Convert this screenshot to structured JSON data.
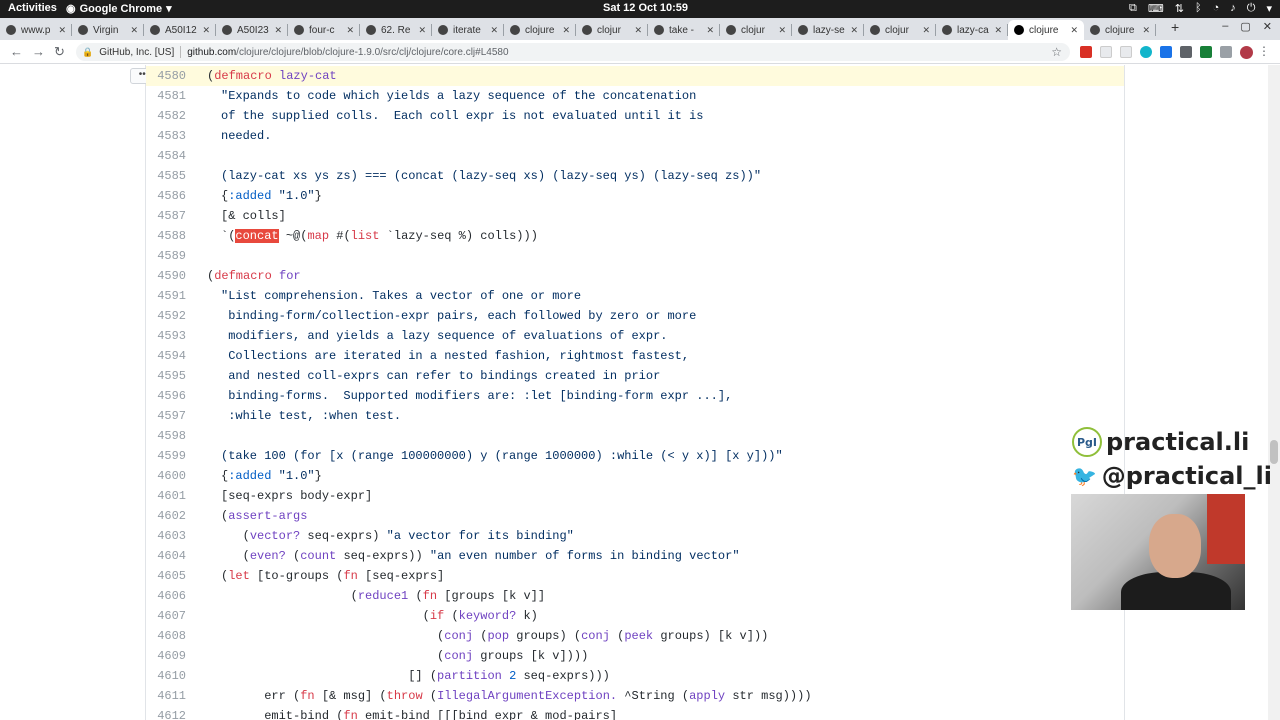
{
  "topbar": {
    "activities": "Activities",
    "app_name": "Google Chrome",
    "clock": "Sat 12 Oct  10:59"
  },
  "tabs": [
    {
      "label": "www.p",
      "active": false
    },
    {
      "label": "Virgin",
      "active": false
    },
    {
      "label": "A50I12",
      "active": false
    },
    {
      "label": "A50I23",
      "active": false
    },
    {
      "label": "four-c",
      "active": false
    },
    {
      "label": "62. Re",
      "active": false
    },
    {
      "label": "iterate",
      "active": false
    },
    {
      "label": "clojure",
      "active": false
    },
    {
      "label": "clojur",
      "active": false
    },
    {
      "label": "take -",
      "active": false
    },
    {
      "label": "clojur",
      "active": false
    },
    {
      "label": "lazy-se",
      "active": false
    },
    {
      "label": "clojur",
      "active": false
    },
    {
      "label": "lazy-ca",
      "active": false
    },
    {
      "label": "clojure",
      "active": true
    },
    {
      "label": "clojure",
      "active": false
    }
  ],
  "address_bar": {
    "org": "GitHub, Inc. [US]",
    "host": "github.com",
    "path": "/clojure/clojure/blob/clojure-1.9.0/src/clj/clojure/core.clj#L4580"
  },
  "code_lines": [
    {
      "n": "4580",
      "hl": true
    },
    {
      "n": "4581"
    },
    {
      "n": "4582"
    },
    {
      "n": "4583"
    },
    {
      "n": "4584"
    },
    {
      "n": "4585"
    },
    {
      "n": "4586"
    },
    {
      "n": "4587"
    },
    {
      "n": "4588"
    },
    {
      "n": "4589"
    },
    {
      "n": "4590"
    },
    {
      "n": "4591"
    },
    {
      "n": "4592"
    },
    {
      "n": "4593"
    },
    {
      "n": "4594"
    },
    {
      "n": "4595"
    },
    {
      "n": "4596"
    },
    {
      "n": "4597"
    },
    {
      "n": "4598"
    },
    {
      "n": "4599"
    },
    {
      "n": "4600"
    },
    {
      "n": "4601"
    },
    {
      "n": "4602"
    },
    {
      "n": "4603"
    },
    {
      "n": "4604"
    },
    {
      "n": "4605"
    },
    {
      "n": "4606"
    },
    {
      "n": "4607"
    },
    {
      "n": "4608"
    },
    {
      "n": "4609"
    },
    {
      "n": "4610"
    },
    {
      "n": "4611"
    },
    {
      "n": "4612"
    }
  ],
  "code_text": {
    "l4580": [
      "(",
      "defmacro",
      " lazy-cat"
    ],
    "l4581": "\"Expands to code which yields a lazy sequence of the concatenation",
    "l4582": "of the supplied colls.  Each coll expr is not evaluated until it is",
    "l4583": "needed.",
    "l4584": "",
    "l4585": "(lazy-cat xs ys zs) === (concat (lazy-seq xs) (lazy-seq ys) (lazy-seq zs))\"",
    "l4586": [
      "{",
      ":added",
      " ",
      "\"1.0\"",
      "}"
    ],
    "l4587": "[& colls]",
    "l4588": [
      "`(",
      "concat",
      " ~@(",
      "map",
      " #(",
      "list",
      " `lazy-seq %) colls)))"
    ],
    "l4589": "",
    "l4590": [
      "(",
      "defmacro",
      " ",
      "for"
    ],
    "l4591": "\"List comprehension. Takes a vector of one or more",
    "l4592": " binding-form/collection-expr pairs, each followed by zero or more",
    "l4593": " modifiers, and yields a lazy sequence of evaluations of expr.",
    "l4594": " Collections are iterated in a nested fashion, rightmost fastest,",
    "l4595": " and nested coll-exprs can refer to bindings created in prior",
    "l4596": " binding-forms.  Supported modifiers are: :let [binding-form expr ...],",
    "l4597": " :while test, :when test.",
    "l4598": "",
    "l4599": "(take 100 (for [x (range 100000000) y (range 1000000) :while (< y x)] [x y]))\"",
    "l4600": [
      "{",
      ":added",
      " ",
      "\"1.0\"",
      "}"
    ],
    "l4601": "[seq-exprs body-expr]",
    "l4602": [
      "(",
      "assert-args"
    ],
    "l4603": [
      "   (",
      "vector?",
      " seq-exprs) ",
      "\"a vector for its binding\""
    ],
    "l4604": [
      "   (",
      "even?",
      " (",
      "count",
      " seq-exprs)) ",
      "\"an even number of forms in binding vector\""
    ],
    "l4605": [
      "(",
      "let",
      " [to-groups (",
      "fn",
      " [seq-exprs]"
    ],
    "l4606": [
      "                  (",
      "reduce1",
      " (",
      "fn",
      " [groups [k v]]"
    ],
    "l4607": [
      "                            (",
      "if",
      " (",
      "keyword?",
      " k)"
    ],
    "l4608": [
      "                              (",
      "conj",
      " (",
      "pop",
      " groups) (",
      "conj",
      " (",
      "peek",
      " groups) [k v]))"
    ],
    "l4609": [
      "                              (",
      "conj",
      " groups [k v])))"
    ],
    "l4610": [
      "                          [] (",
      "partition",
      " ",
      "2",
      " seq-exprs)))"
    ],
    "l4611": [
      "      err (",
      "fn",
      " [& msg] (",
      "throw",
      " (",
      "IllegalArgumentException.",
      " ^String (",
      "apply",
      " str msg))))"
    ],
    "l4612": [
      "      emit-bind (",
      "fn",
      " emit-bind [[[bind expr & mod-pairs]"
    ]
  },
  "brand": {
    "logo_text": "PgI",
    "site": "practical.li",
    "handle": "@practical_li"
  },
  "colors": {
    "keyword": "#d73a49",
    "string": "#032f62",
    "entity": "#6f42c1",
    "constant": "#005cc5",
    "search_highlight": "#e8493d",
    "line_highlight": "#fffbdd"
  }
}
